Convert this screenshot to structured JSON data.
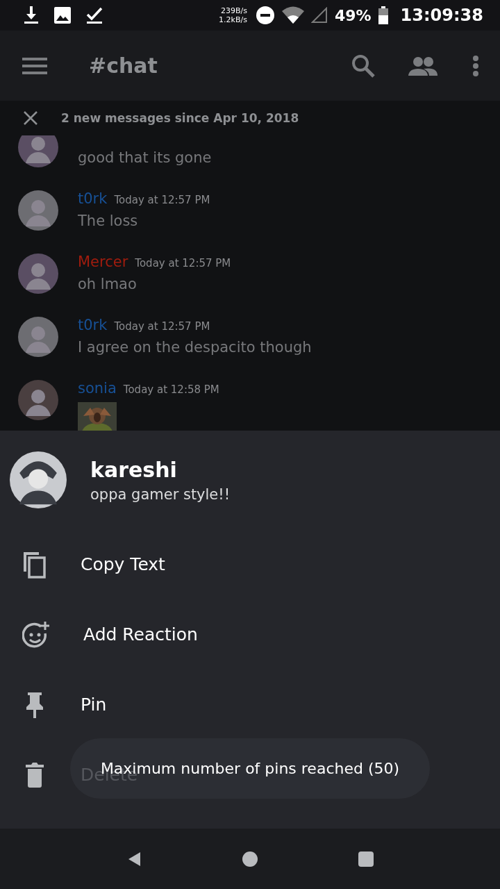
{
  "status_bar": {
    "net_up": "239B/s",
    "net_down": "1.2kB/s",
    "battery": "49%",
    "time": "13:09:38"
  },
  "toolbar": {
    "title": "#chat"
  },
  "banner": {
    "text": "2 new messages since Apr 10, 2018"
  },
  "messages": [
    {
      "text": "good that its gone",
      "kind": "text"
    },
    {
      "author": "t0rk",
      "color": "#175095",
      "time": "Today at 12:57 PM",
      "text": "The loss",
      "kind": "text"
    },
    {
      "author": "Mercer",
      "color": "#a01c0e",
      "time": "Today at 12:57 PM",
      "text": "oh lmao",
      "kind": "text"
    },
    {
      "author": "t0rk",
      "color": "#175095",
      "time": "Today at 12:57 PM",
      "text": "I agree on the despacito though",
      "kind": "text"
    },
    {
      "author": "sonia",
      "color": "#175095",
      "time": "Today at 12:58 PM",
      "kind": "sticker"
    }
  ],
  "sheet": {
    "user": "kareshi",
    "status": "oppa gamer style!!",
    "actions": [
      {
        "kind": "copy",
        "label": "Copy Text"
      },
      {
        "kind": "reaction",
        "label": "Add Reaction"
      },
      {
        "kind": "pin",
        "label": "Pin"
      },
      {
        "kind": "delete",
        "label": "Delete"
      }
    ]
  },
  "toast": {
    "text": "Maximum number of pins reached (50)"
  }
}
